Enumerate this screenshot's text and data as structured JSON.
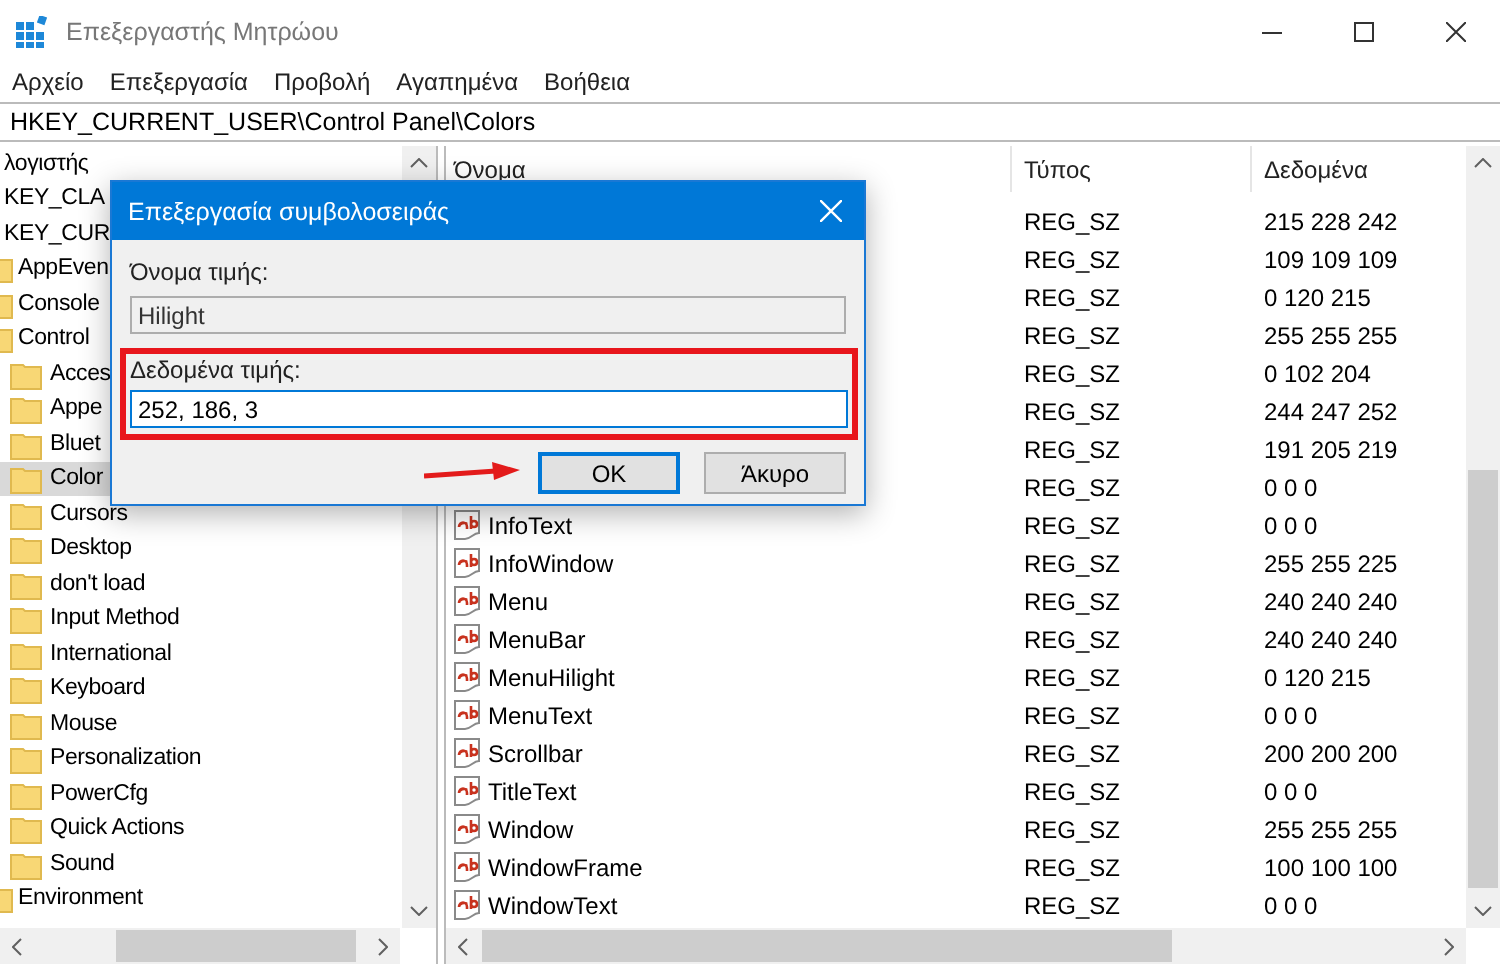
{
  "window": {
    "title": "Επεξεργαστής Μητρώου"
  },
  "menu": [
    "Αρχείο",
    "Επεξεργασία",
    "Προβολή",
    "Αγαπημένα",
    "Βοήθεια"
  ],
  "address": "HKEY_CURRENT_USER\\Control Panel\\Colors",
  "tree": {
    "label": "λογιστής",
    "selected": false,
    "children": [
      {
        "label": "KEY_CLA",
        "selected": false
      },
      {
        "label": "KEY_CUR",
        "selected": false,
        "children": [
          {
            "label": "AppEven",
            "selected": false
          },
          {
            "label": "Console",
            "selected": false
          },
          {
            "label": "Control",
            "selected": false,
            "children": [
              {
                "label": "Acces",
                "selected": false
              },
              {
                "label": "Appe",
                "selected": false
              },
              {
                "label": "Bluet",
                "selected": false
              },
              {
                "label": "Color",
                "selected": true
              },
              {
                "label": "Cursors",
                "selected": false
              },
              {
                "label": "Desktop",
                "selected": false
              },
              {
                "label": "don't load",
                "selected": false
              },
              {
                "label": "Input Method",
                "selected": false
              },
              {
                "label": "International",
                "selected": false
              },
              {
                "label": "Keyboard",
                "selected": false
              },
              {
                "label": "Mouse",
                "selected": false
              },
              {
                "label": "Personalization",
                "selected": false
              },
              {
                "label": "PowerCfg",
                "selected": false
              },
              {
                "label": "Quick Actions",
                "selected": false
              },
              {
                "label": "Sound",
                "selected": false
              }
            ]
          },
          {
            "label": "Environment",
            "selected": false
          }
        ]
      }
    ]
  },
  "values": {
    "columns": [
      "Όνομα",
      "Τύπος",
      "Δεδομένα"
    ],
    "rows": [
      {
        "type": "REG_SZ",
        "data": "215 228 242"
      },
      {
        "type": "REG_SZ",
        "data": "109 109 109"
      },
      {
        "type": "REG_SZ",
        "data": "0 120 215"
      },
      {
        "type": "REG_SZ",
        "data": "255 255 255"
      },
      {
        "type": "REG_SZ",
        "data": "0 102 204"
      },
      {
        "type": "REG_SZ",
        "data": "244 247 252"
      },
      {
        "type": "REG_SZ",
        "data": "191 205 219"
      },
      {
        "type": "REG_SZ",
        "data": "0 0 0"
      },
      {
        "name": "InfoText",
        "type": "REG_SZ",
        "data": "0 0 0"
      },
      {
        "name": "InfoWindow",
        "type": "REG_SZ",
        "data": "255 255 225"
      },
      {
        "name": "Menu",
        "type": "REG_SZ",
        "data": "240 240 240"
      },
      {
        "name": "MenuBar",
        "type": "REG_SZ",
        "data": "240 240 240"
      },
      {
        "name": "MenuHilight",
        "type": "REG_SZ",
        "data": "0 120 215"
      },
      {
        "name": "MenuText",
        "type": "REG_SZ",
        "data": "0 0 0"
      },
      {
        "name": "Scrollbar",
        "type": "REG_SZ",
        "data": "200 200 200"
      },
      {
        "name": "TitleText",
        "type": "REG_SZ",
        "data": "0 0 0"
      },
      {
        "name": "Window",
        "type": "REG_SZ",
        "data": "255 255 255"
      },
      {
        "name": "WindowFrame",
        "type": "REG_SZ",
        "data": "100 100 100"
      },
      {
        "name": "WindowText",
        "type": "REG_SZ",
        "data": "0 0 0"
      }
    ]
  },
  "dialog": {
    "title": "Επεξεργασία συμβολοσειράς",
    "name_label": "Όνομα τιμής:",
    "name_value": "Hilight",
    "data_label": "Δεδομένα τιμής:",
    "data_value": "252, 186, 3",
    "buttons": [
      {
        "label": "OK",
        "default": true
      },
      {
        "label": "Άκυρο",
        "default": false
      }
    ]
  }
}
